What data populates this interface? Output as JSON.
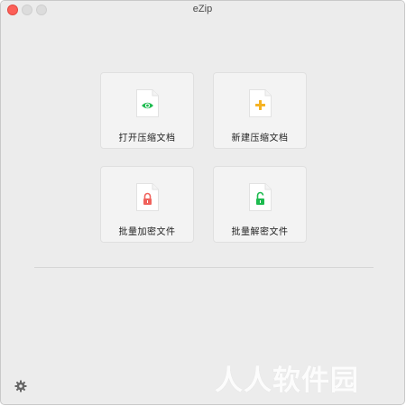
{
  "window": {
    "title": "eZip"
  },
  "tiles": [
    {
      "label": "打开压缩文档",
      "icon": "eye-icon",
      "accent": "#1dbb4f"
    },
    {
      "label": "新建压缩文档",
      "icon": "plus-icon",
      "accent": "#f5b324"
    },
    {
      "label": "批量加密文件",
      "icon": "lock-closed-icon",
      "accent": "#f0625c"
    },
    {
      "label": "批量解密文件",
      "icon": "lock-open-icon",
      "accent": "#1dbb4f"
    }
  ],
  "footer": {
    "settings_icon": "gear-icon"
  },
  "watermark": {
    "text": "人人软件园"
  }
}
